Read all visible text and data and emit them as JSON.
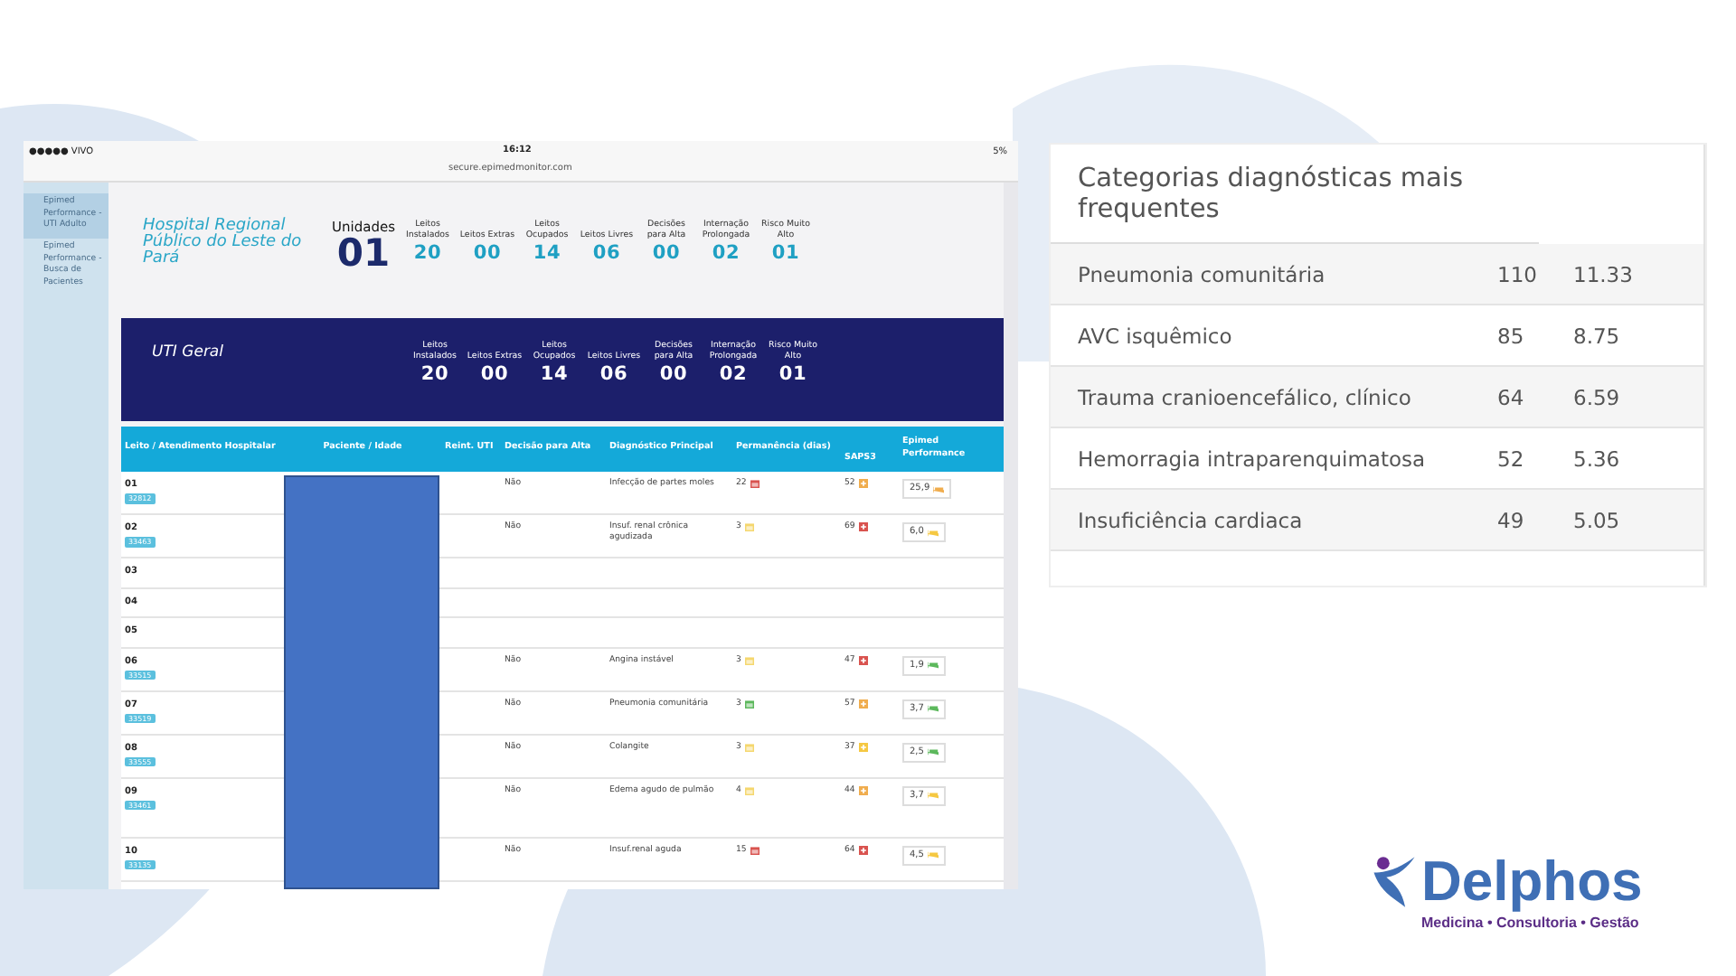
{
  "phone_status": {
    "carrier": "●●●●● VIVO",
    "time": "16:12",
    "battery": "5%",
    "url": "secure.epimedmonitor.com"
  },
  "sidebar": {
    "items": [
      {
        "label": "Epimed Performance - UTI Adulto",
        "selected": true
      },
      {
        "label": "Epimed Performance - Busca de Pacientes",
        "selected": false
      }
    ]
  },
  "hospital": {
    "name": "Hospital Regional Público do Leste do Pará",
    "units_label": "Unidades",
    "units": "01",
    "stats": [
      {
        "label": "Leitos Instalados",
        "value": "20"
      },
      {
        "label": "Leitos Extras",
        "value": "00"
      },
      {
        "label": "Leitos Ocupados",
        "value": "14"
      },
      {
        "label": "Leitos Livres",
        "value": "06"
      },
      {
        "label": "Decisões para Alta",
        "value": "00"
      },
      {
        "label": "Internação Prolongada",
        "value": "02"
      },
      {
        "label": "Risco Muito Alto",
        "value": "01"
      }
    ]
  },
  "unit": {
    "name": "UTI Geral",
    "stats": [
      {
        "label": "Leitos Instalados",
        "value": "20"
      },
      {
        "label": "Leitos Extras",
        "value": "00"
      },
      {
        "label": "Leitos Ocupados",
        "value": "14"
      },
      {
        "label": "Leitos Livres",
        "value": "06"
      },
      {
        "label": "Decisões para Alta",
        "value": "00"
      },
      {
        "label": "Internação Prolongada",
        "value": "02"
      },
      {
        "label": "Risco Muito Alto",
        "value": "01"
      }
    ]
  },
  "table": {
    "columns": [
      "Leito / Atendimento Hospitalar",
      "Paciente / Idade",
      "Reint. UTI",
      "Decisão para Alta",
      "Diagnóstico Principal",
      "Permanência (dias)",
      "SAPS3",
      "Epimed Performance"
    ],
    "rows": [
      {
        "bed": "01",
        "code": "32812",
        "decision": "Não",
        "diagnosis": "Infecção de partes moles",
        "stay": {
          "value": "22",
          "color": "#d9534f"
        },
        "saps": {
          "value": "52",
          "color": "#f0ad4e"
        },
        "performance": {
          "value": "25,9",
          "color": "#f0ad4e"
        }
      },
      {
        "bed": "02",
        "code": "33463",
        "decision": "Não",
        "diagnosis": "Insuf. renal crônica agudizada",
        "stay": {
          "value": "3",
          "color": "#f5d76e"
        },
        "saps": {
          "value": "69",
          "color": "#d9534f"
        },
        "performance": {
          "value": "6,0",
          "color": "#f5c842"
        }
      },
      {
        "bed": "03"
      },
      {
        "bed": "04"
      },
      {
        "bed": "05"
      },
      {
        "bed": "06",
        "code": "33515",
        "decision": "Não",
        "diagnosis": "Angina instável",
        "stay": {
          "value": "3",
          "color": "#f5d76e"
        },
        "saps": {
          "value": "47",
          "color": "#d9534f"
        },
        "performance": {
          "value": "1,9",
          "color": "#5cb85c"
        }
      },
      {
        "bed": "07",
        "code": "33519",
        "decision": "Não",
        "diagnosis": "Pneumonia comunitária",
        "stay": {
          "value": "3",
          "color": "#5cb85c"
        },
        "saps": {
          "value": "57",
          "color": "#f0ad4e"
        },
        "performance": {
          "value": "3,7",
          "color": "#5cb85c"
        }
      },
      {
        "bed": "08",
        "code": "33555",
        "decision": "Não",
        "diagnosis": "Colangite",
        "stay": {
          "value": "3",
          "color": "#f5d76e"
        },
        "saps": {
          "value": "37",
          "color": "#f5c842"
        },
        "performance": {
          "value": "2,5",
          "color": "#5cb85c"
        }
      },
      {
        "bed": "09",
        "code": "33461",
        "decision": "Não",
        "diagnosis": "Edema agudo de pulmão",
        "stay": {
          "value": "4",
          "color": "#f5d76e"
        },
        "saps": {
          "value": "44",
          "color": "#f0ad4e"
        },
        "performance": {
          "value": "3,7",
          "color": "#f5c842"
        }
      },
      {
        "bed": "10",
        "code": "33135",
        "decision": "Não",
        "diagnosis": "Insuf.renal aguda",
        "stay": {
          "value": "15",
          "color": "#d9534f"
        },
        "saps": {
          "value": "64",
          "color": "#d9534f"
        },
        "performance": {
          "value": "4,5",
          "color": "#f5c842"
        }
      }
    ]
  },
  "categories": {
    "title": "Categorias diagnósticas mais frequentes",
    "rows": [
      {
        "name": "Pneumonia comunitária",
        "count": "110",
        "percent": "11.33"
      },
      {
        "name": "AVC isquêmico",
        "count": "85",
        "percent": "8.75"
      },
      {
        "name": "Trauma cranioencefálico, clínico",
        "count": "64",
        "percent": "6.59"
      },
      {
        "name": "Hemorragia intraparenquimatosa",
        "count": "52",
        "percent": "5.36"
      },
      {
        "name": "Insuficiência cardiaca",
        "count": "49",
        "percent": "5.05"
      }
    ]
  },
  "logo": {
    "name": "Delphos",
    "tagline": "Medicina • Consultoria • Gestão"
  }
}
